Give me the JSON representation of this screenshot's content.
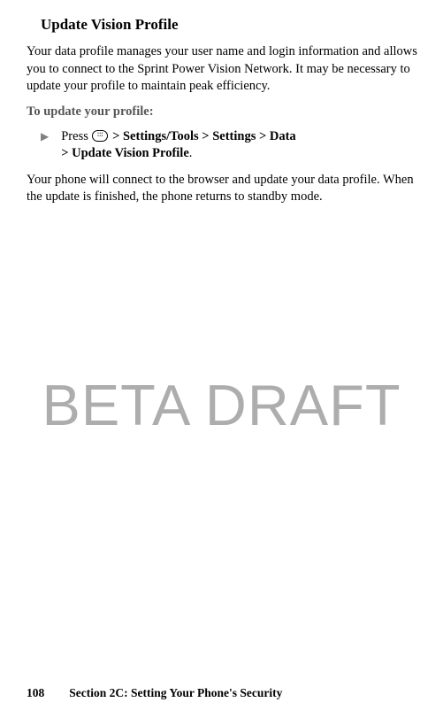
{
  "heading": "Update Vision Profile",
  "intro": "Your data profile manages your user name and login information and allows you to connect to the Sprint Power Vision Network. It may be necessary to update your profile to maintain peak efficiency.",
  "subheading": "To update your profile:",
  "instruction": {
    "press_label": "Press ",
    "path_1": " > Settings/Tools > Settings > Data",
    "path_2": "> Update Vision Profile",
    "period": "."
  },
  "result": "Your phone will connect to the browser and update your data profile. When the update is finished, the phone returns to standby mode.",
  "watermark": "BETA DRAFT",
  "footer": {
    "page_number": "108",
    "section": "Section 2C: Setting Your Phone's Security"
  }
}
